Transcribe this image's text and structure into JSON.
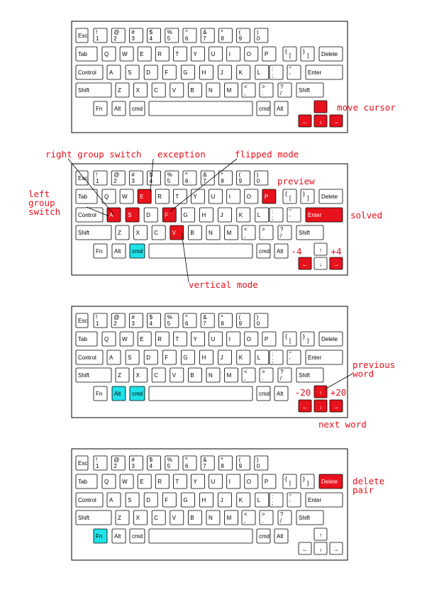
{
  "colors": {
    "highlight": "#e8121c",
    "modifier": "#1fe2e8",
    "annotation": "#e8101c",
    "frame": "#000000",
    "key_fill": "#ffffff"
  },
  "keyboard_labels": {
    "esc": "Esc",
    "number_row": [
      [
        "!",
        "1"
      ],
      [
        "@",
        "2"
      ],
      [
        "#",
        "3"
      ],
      [
        "$",
        "4"
      ],
      [
        "%",
        "5"
      ],
      [
        "^",
        "6"
      ],
      [
        "&",
        "7"
      ],
      [
        "*",
        "8"
      ],
      [
        "(",
        "9"
      ],
      [
        ")",
        "0"
      ]
    ],
    "tab": "Tab",
    "qwerty_row": [
      "Q",
      "W",
      "E",
      "R",
      "T",
      "Y",
      "U",
      "I",
      "O",
      "P"
    ],
    "brackets": [
      [
        "{",
        "["
      ],
      [
        "}",
        "]"
      ]
    ],
    "delete": "Delete",
    "control": "Control",
    "home_row": [
      "A",
      "S",
      "D",
      "F",
      "G",
      "H",
      "J",
      "K",
      "L"
    ],
    "semicolon": [
      ":",
      ";"
    ],
    "quote": [
      "\"",
      "'"
    ],
    "enter": "Enter",
    "shift": "Shift",
    "bottom_letters": [
      "Z",
      "X",
      "C",
      "V",
      "B",
      "N",
      "M"
    ],
    "comma": [
      "<",
      ","
    ],
    "period": [
      ">",
      "."
    ],
    "slash": [
      "?",
      "/"
    ],
    "fn": "Fn",
    "alt": "Alt",
    "cmd": "cmd",
    "arrows": {
      "up": "↑",
      "left": "←",
      "down": "↓",
      "right": "→"
    }
  },
  "panels": [
    {
      "id": "panel-1",
      "highlighted_red": [
        "up",
        "left",
        "down",
        "right"
      ],
      "highlighted_cyan": [],
      "arrow_labels_visible": [
        "left",
        "down",
        "right"
      ],
      "annotations": {
        "move_cursor": "move cursor"
      }
    },
    {
      "id": "panel-2",
      "highlighted_red": [
        "E",
        "P",
        "A",
        "S",
        "F",
        "V",
        "Enter",
        "left",
        "right"
      ],
      "highlighted_cyan": [
        "cmd-left"
      ],
      "arrow_labels_visible": [
        "up",
        "left",
        "down",
        "right"
      ],
      "annotations": {
        "right_group_switch": "right group switch",
        "exception": "exception",
        "flipped_mode": "flipped mode",
        "preview": "preview",
        "left_group_switch": [
          "left",
          "group",
          "switch"
        ],
        "solved": "solved",
        "minus_4": "-4",
        "plus_4": "+4",
        "vertical_mode": "vertical mode"
      }
    },
    {
      "id": "panel-3",
      "highlighted_red": [
        "up",
        "left",
        "down",
        "right"
      ],
      "highlighted_cyan": [
        "Alt-left",
        "cmd-left"
      ],
      "arrow_labels_visible": [
        "up",
        "left",
        "down",
        "right"
      ],
      "annotations": {
        "previous_word": [
          "previous",
          "word"
        ],
        "minus_20": "-20",
        "plus_20": "+20",
        "next_word": "next word"
      }
    },
    {
      "id": "panel-4",
      "highlighted_red": [
        "Delete"
      ],
      "highlighted_cyan": [
        "Fn"
      ],
      "arrow_labels_visible": [
        "up",
        "left",
        "down",
        "right"
      ],
      "annotations": {
        "delete_pair": [
          "delete",
          "pair"
        ]
      }
    }
  ]
}
